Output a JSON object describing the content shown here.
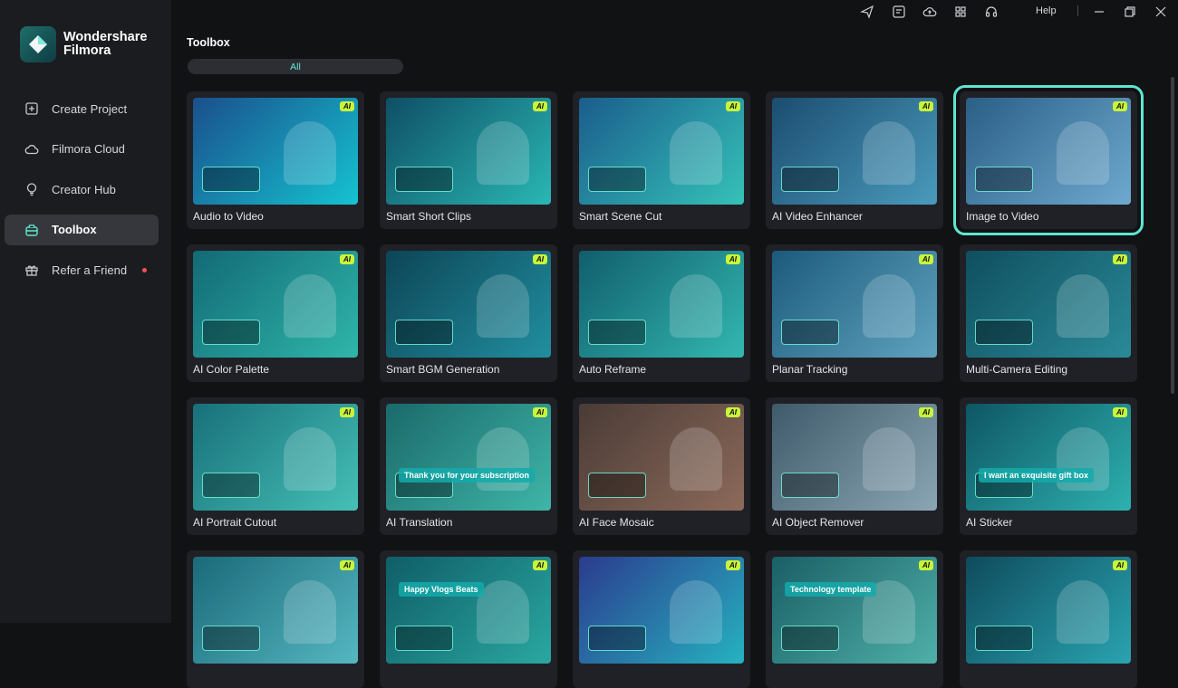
{
  "brand": {
    "line1": "Wondershare",
    "line2": "Filmora"
  },
  "sidebar": {
    "items": [
      {
        "label": "Create Project",
        "icon": "plus-square-icon"
      },
      {
        "label": "Filmora Cloud",
        "icon": "cloud-icon"
      },
      {
        "label": "Creator Hub",
        "icon": "bulb-icon"
      },
      {
        "label": "Toolbox",
        "icon": "toolbox-icon",
        "active": true
      },
      {
        "label": "Refer a Friend",
        "icon": "gift-icon",
        "badge_dot": true
      }
    ]
  },
  "topbar": {
    "icons": [
      "send-icon",
      "inbox-icon",
      "cloud-upload-icon",
      "apps-grid-icon",
      "headset-icon"
    ],
    "help_label": "Help",
    "window_controls": [
      "minimize-icon",
      "restore-icon",
      "close-icon"
    ]
  },
  "main": {
    "title": "Toolbox",
    "filter_label": "All",
    "ai_badge": "AI",
    "cards": [
      {
        "label": "Audio to Video",
        "colors": [
          "#1a4f8c",
          "#15c3d1"
        ]
      },
      {
        "label": "Smart Short Clips",
        "colors": [
          "#0e4f65",
          "#2ab7b4"
        ]
      },
      {
        "label": "Smart Scene Cut",
        "colors": [
          "#1a5d8c",
          "#35c2b8"
        ]
      },
      {
        "label": "AI Video Enhancer",
        "colors": [
          "#1b4d70",
          "#4a9abc"
        ]
      },
      {
        "label": "Image to Video",
        "colors": [
          "#2a5f86",
          "#6fa9cf"
        ],
        "selected": true
      },
      {
        "label": "AI Color Palette",
        "colors": [
          "#126a76",
          "#2fb6aa"
        ]
      },
      {
        "label": "Smart BGM Generation",
        "colors": [
          "#0c4556",
          "#218fa0"
        ]
      },
      {
        "label": "Auto Reframe",
        "colors": [
          "#105e6d",
          "#33b8b0"
        ]
      },
      {
        "label": "Planar Tracking",
        "colors": [
          "#1c5a7c",
          "#5fa3bf"
        ]
      },
      {
        "label": "Multi-Camera Editing",
        "colors": [
          "#0f4f5f",
          "#2a8a98"
        ]
      },
      {
        "label": "AI Portrait Cutout",
        "colors": [
          "#18707a",
          "#45c0b6"
        ]
      },
      {
        "label": "AI Translation",
        "colors": [
          "#1a6a6a",
          "#3fb5a8"
        ]
      },
      {
        "label": "AI Face Mosaic",
        "colors": [
          "#4a3b36",
          "#8c6a5a"
        ]
      },
      {
        "label": "AI Object Remover",
        "colors": [
          "#3f5a6a",
          "#8aa6b4"
        ]
      },
      {
        "label": "AI Sticker",
        "colors": [
          "#0e5664",
          "#2eb1b0"
        ]
      },
      {
        "label": "",
        "colors": [
          "#1b6a7a",
          "#55b7c1"
        ]
      },
      {
        "label": "",
        "colors": [
          "#0f5e68",
          "#2aa7a0"
        ]
      },
      {
        "label": "",
        "colors": [
          "#2b3b8e",
          "#26b2c0"
        ]
      },
      {
        "label": "",
        "colors": [
          "#1a5f66",
          "#4fb0a8"
        ]
      },
      {
        "label": "",
        "colors": [
          "#0e4b5d",
          "#2aa4b0"
        ]
      }
    ],
    "thumb_texts": {
      "translation_caption": "Thank you for your subscription",
      "sticker_prompt": "I want an exquisite gift box",
      "bgm_title": "Happy Vlogs Beats",
      "template_label": "Technology template"
    }
  }
}
